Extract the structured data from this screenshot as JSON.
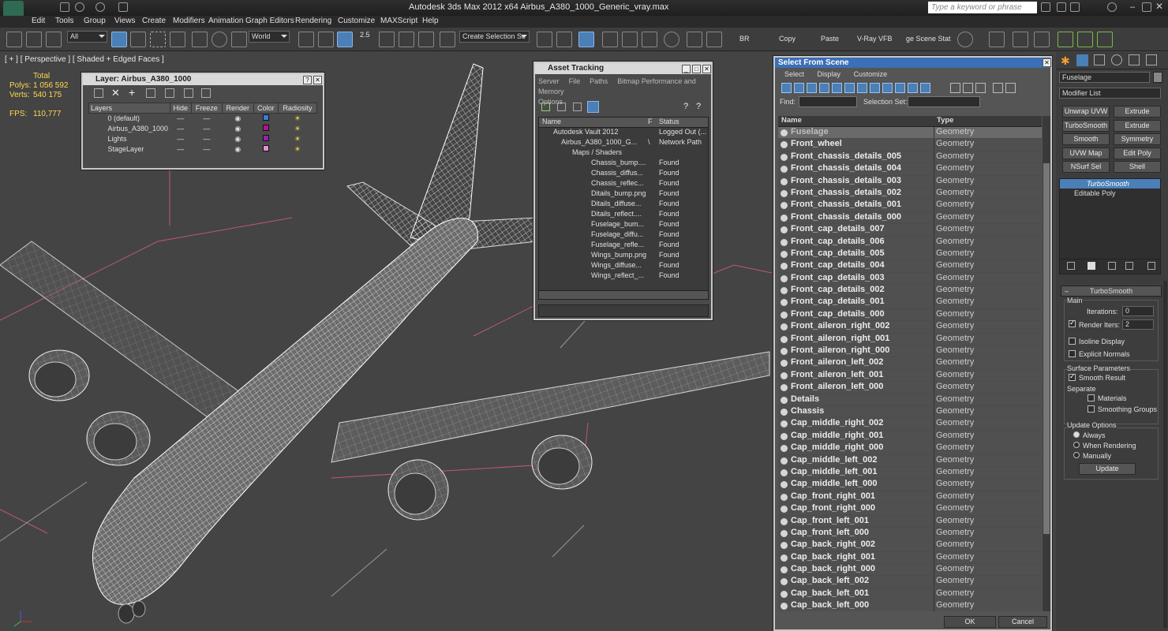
{
  "window": {
    "title": "Autodesk 3ds Max  2012 x64     Airbus_A380_1000_Generic_vray.max",
    "search_placeholder": "Type a keyword or phrase"
  },
  "menu": [
    "Edit",
    "Tools",
    "Group",
    "Views",
    "Create",
    "Modifiers",
    "Animation",
    "Graph Editors",
    "Rendering",
    "Customize",
    "MAXScript",
    "Help"
  ],
  "toolbar": {
    "filter": "All",
    "coord": "World",
    "snap": "2.5",
    "selection_set": "Create Selection Se",
    "text_buttons": [
      "BR",
      "Copy",
      "Paste",
      "V-Ray VFB",
      "ge Scene Stat"
    ]
  },
  "viewport": {
    "label": "[ + ] [ Perspective ] [ Shaded + Edged Faces ]",
    "stats": {
      "total_label": "Total",
      "polys_label": "Polys:",
      "polys": "1 056 592",
      "verts_label": "Verts:",
      "verts": "540 175",
      "fps_label": "FPS:",
      "fps": "110,777"
    }
  },
  "layer_window": {
    "title": "Layer: Airbus_A380_1000",
    "columns": [
      "Layers",
      "Hide",
      "Freeze",
      "Render",
      "Color",
      "Radiosity"
    ],
    "rows": [
      {
        "name": "0 (default)",
        "color": "#3a7fd5"
      },
      {
        "name": "Airbus_A380_1000",
        "color": "#b4148a"
      },
      {
        "name": "Lights",
        "color": "#9a1faa"
      },
      {
        "name": "StageLayer",
        "color": "#f08ad6"
      }
    ]
  },
  "asset_window": {
    "title": "Asset Tracking",
    "menu": [
      "Server",
      "File",
      "Paths",
      "Bitmap Performance and Memory",
      "Options"
    ],
    "columns": [
      "Name",
      "F",
      "Status"
    ],
    "rows": [
      {
        "name": "Autodesk Vault 2012",
        "f": "",
        "status": "Logged Out (..."
      },
      {
        "name": "Airbus_A380_1000_G...",
        "f": "\\",
        "status": "Network Path"
      },
      {
        "name": "Maps / Shaders",
        "f": "",
        "status": ""
      },
      {
        "name": "Chassis_bump....",
        "f": "",
        "status": "Found"
      },
      {
        "name": "Chassis_diffus...",
        "f": "",
        "status": "Found"
      },
      {
        "name": "Chassis_reflec...",
        "f": "",
        "status": "Found"
      },
      {
        "name": "Ditails_bump.png",
        "f": "",
        "status": "Found"
      },
      {
        "name": "Ditails_diffuse...",
        "f": "",
        "status": "Found"
      },
      {
        "name": "Ditails_reflect....",
        "f": "",
        "status": "Found"
      },
      {
        "name": "Fuselage_bum...",
        "f": "",
        "status": "Found"
      },
      {
        "name": "Fuselage_diffu...",
        "f": "",
        "status": "Found"
      },
      {
        "name": "Fuselage_refle...",
        "f": "",
        "status": "Found"
      },
      {
        "name": "Wings_bump.png",
        "f": "",
        "status": "Found"
      },
      {
        "name": "Wings_diffuse...",
        "f": "",
        "status": "Found"
      },
      {
        "name": "Wings_reflect_...",
        "f": "",
        "status": "Found"
      }
    ]
  },
  "select_window": {
    "title": "Select From Scene",
    "menu": [
      "Select",
      "Display",
      "Customize"
    ],
    "find_label": "Find:",
    "selection_sets_label": "Selection Set:",
    "columns": [
      "Name",
      "Type"
    ],
    "rows": [
      {
        "name": "Fuselage",
        "type": "Geometry"
      },
      {
        "name": "Front_wheel",
        "type": "Geometry"
      },
      {
        "name": "Front_chassis_details_005",
        "type": "Geometry"
      },
      {
        "name": "Front_chassis_details_004",
        "type": "Geometry"
      },
      {
        "name": "Front_chassis_details_003",
        "type": "Geometry"
      },
      {
        "name": "Front_chassis_details_002",
        "type": "Geometry"
      },
      {
        "name": "Front_chassis_details_001",
        "type": "Geometry"
      },
      {
        "name": "Front_chassis_details_000",
        "type": "Geometry"
      },
      {
        "name": "Front_cap_details_007",
        "type": "Geometry"
      },
      {
        "name": "Front_cap_details_006",
        "type": "Geometry"
      },
      {
        "name": "Front_cap_details_005",
        "type": "Geometry"
      },
      {
        "name": "Front_cap_details_004",
        "type": "Geometry"
      },
      {
        "name": "Front_cap_details_003",
        "type": "Geometry"
      },
      {
        "name": "Front_cap_details_002",
        "type": "Geometry"
      },
      {
        "name": "Front_cap_details_001",
        "type": "Geometry"
      },
      {
        "name": "Front_cap_details_000",
        "type": "Geometry"
      },
      {
        "name": "Front_aileron_right_002",
        "type": "Geometry"
      },
      {
        "name": "Front_aileron_right_001",
        "type": "Geometry"
      },
      {
        "name": "Front_aileron_right_000",
        "type": "Geometry"
      },
      {
        "name": "Front_aileron_left_002",
        "type": "Geometry"
      },
      {
        "name": "Front_aileron_left_001",
        "type": "Geometry"
      },
      {
        "name": "Front_aileron_left_000",
        "type": "Geometry"
      },
      {
        "name": "Details",
        "type": "Geometry"
      },
      {
        "name": "Chassis",
        "type": "Geometry"
      },
      {
        "name": "Cap_middle_right_002",
        "type": "Geometry"
      },
      {
        "name": "Cap_middle_right_001",
        "type": "Geometry"
      },
      {
        "name": "Cap_middle_right_000",
        "type": "Geometry"
      },
      {
        "name": "Cap_middle_left_002",
        "type": "Geometry"
      },
      {
        "name": "Cap_middle_left_001",
        "type": "Geometry"
      },
      {
        "name": "Cap_middle_left_000",
        "type": "Geometry"
      },
      {
        "name": "Cap_front_right_001",
        "type": "Geometry"
      },
      {
        "name": "Cap_front_right_000",
        "type": "Geometry"
      },
      {
        "name": "Cap_front_left_001",
        "type": "Geometry"
      },
      {
        "name": "Cap_front_left_000",
        "type": "Geometry"
      },
      {
        "name": "Cap_back_right_002",
        "type": "Geometry"
      },
      {
        "name": "Cap_back_right_001",
        "type": "Geometry"
      },
      {
        "name": "Cap_back_right_000",
        "type": "Geometry"
      },
      {
        "name": "Cap_back_left_002",
        "type": "Geometry"
      },
      {
        "name": "Cap_back_left_001",
        "type": "Geometry"
      },
      {
        "name": "Cap_back_left_000",
        "type": "Geometry"
      }
    ],
    "ok": "OK",
    "cancel": "Cancel"
  },
  "command_panel": {
    "object_name": "Fuselage",
    "modifier_list": "Modifier List",
    "buttons": [
      "Unwrap UVW",
      "Extrude",
      "TurboSmooth",
      "Extrude",
      "Smooth",
      "Symmetry",
      "UVW Map",
      "Edit Poly",
      "NSurf Sel",
      "Shell"
    ],
    "stack": [
      "TurboSmooth",
      "Editable Poly"
    ],
    "rollout_title": "TurboSmooth",
    "main_label": "Main",
    "iterations_label": "Iterations:",
    "iterations": "0",
    "render_iters_label": "Render Iters:",
    "render_iters": "2",
    "isoline_label": "Isoline Display",
    "explicit_label": "Explicit Normals",
    "surface_label": "Surface Parameters",
    "smooth_result_label": "Smooth Result",
    "separate_label": "Separate",
    "materials_label": "Materials",
    "smoothing_groups_label": "Smoothing Groups",
    "update_options_label": "Update Options",
    "always_label": "Always",
    "when_rendering_label": "When Rendering",
    "manually_label": "Manually",
    "update_button": "Update"
  }
}
